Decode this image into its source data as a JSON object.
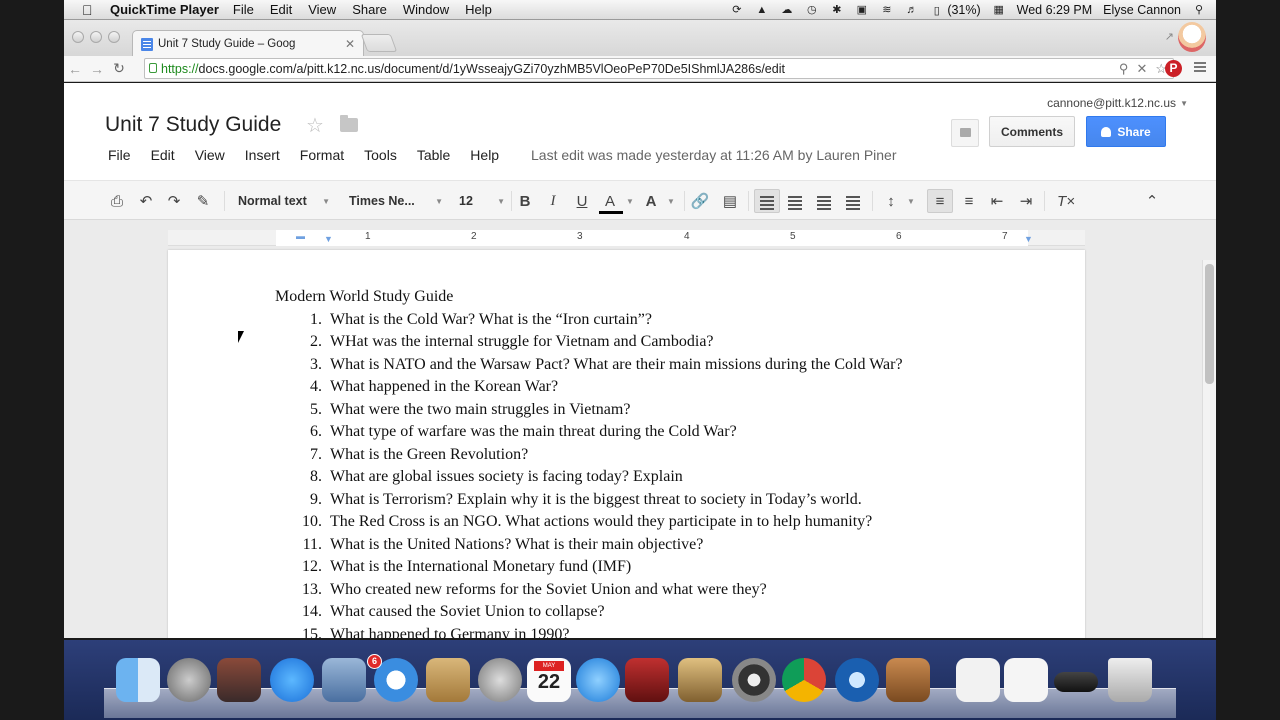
{
  "menubar": {
    "app_name": "QuickTime Player",
    "menus": [
      "File",
      "Edit",
      "View",
      "Share",
      "Window",
      "Help"
    ],
    "battery": "(31%)",
    "clock": "Wed 6:29 PM",
    "user": "Elyse Cannon"
  },
  "browser": {
    "tab_title": "Unit 7 Study Guide – Goog",
    "url_scheme": "https://",
    "url_rest": "docs.google.com/a/pitt.k12.nc.us/document/d/1yWsseajyGZi70yzhMB5VlOeoPeP70De5IShmlJA286s/edit"
  },
  "docs": {
    "title": "Unit 7 Study Guide",
    "account": "cannone@pitt.k12.nc.us",
    "comments_label": "Comments",
    "share_label": "Share",
    "menu": [
      "File",
      "Edit",
      "View",
      "Insert",
      "Format",
      "Tools",
      "Table",
      "Help"
    ],
    "last_edit": "Last edit was made yesterday at 11:26 AM by Lauren Piner"
  },
  "format_toolbar": {
    "style": "Normal text",
    "font": "Times Ne...",
    "size": "12",
    "bold": "B",
    "italic": "I",
    "underline": "U",
    "text_color": "A",
    "highlight": "A"
  },
  "ruler": [
    "1",
    "2",
    "3",
    "4",
    "5",
    "6",
    "7"
  ],
  "document": {
    "heading": "Modern World Study Guide",
    "questions": [
      {
        "n": "1.",
        "t": "What is the Cold War? What is the “Iron curtain”?"
      },
      {
        "n": "2.",
        "t": "WHat was the internal struggle for Vietnam and Cambodia?"
      },
      {
        "n": "3.",
        "t": "What is NATO and the Warsaw Pact? What are their main missions during the Cold War?"
      },
      {
        "n": "4.",
        "t": "What happened in the Korean War?"
      },
      {
        "n": "5.",
        "t": "What were the two main struggles in Vietnam?"
      },
      {
        "n": "6.",
        "t": "What type of warfare was the main threat during the Cold War?"
      },
      {
        "n": "7.",
        "t": "What is the Green Revolution?"
      },
      {
        "n": "8.",
        "t": "What are global issues society is facing today? Explain"
      },
      {
        "n": "9.",
        "t": "What is Terrorism? Explain why it is the biggest threat to society in Today’s world."
      },
      {
        "n": "10.",
        "t": "The Red Cross is an NGO. What actions would they participate in to help humanity?"
      },
      {
        "n": "11.",
        "t": "What is the United Nations? What is their main objective?"
      },
      {
        "n": "12.",
        "t": "What is the International Monetary fund (IMF)"
      },
      {
        "n": "13.",
        "t": "Who created new reforms for the Soviet Union and what were they?"
      },
      {
        "n": "14.",
        "t": "What caused the Soviet Union to collapse?"
      },
      {
        "n": "15.",
        "t": "What happened to Germany in 1990?"
      }
    ]
  },
  "dock": {
    "app_store_badge": "6",
    "calendar_month": "MAY",
    "calendar_day": "22",
    "icons": [
      "finder-icon",
      "launchpad-icon",
      "photo-booth-icon",
      "app-store-icon",
      "mail-icon",
      "safari-icon",
      "contacts-icon",
      "system-preferences-icon",
      "calendar-icon",
      "itunes-icon",
      "photo-slideshow-icon",
      "iphoto-icon",
      "dvd-player-icon",
      "chrome-icon",
      "quicktime-icon",
      "preview-icon",
      "documents-icon",
      "pages-icon",
      "screen-icon",
      "trash-icon"
    ]
  },
  "colors": {
    "share_blue": "#4d90fe",
    "dock_blue": "#1b2a57",
    "pinterest_red": "#cb2027"
  }
}
